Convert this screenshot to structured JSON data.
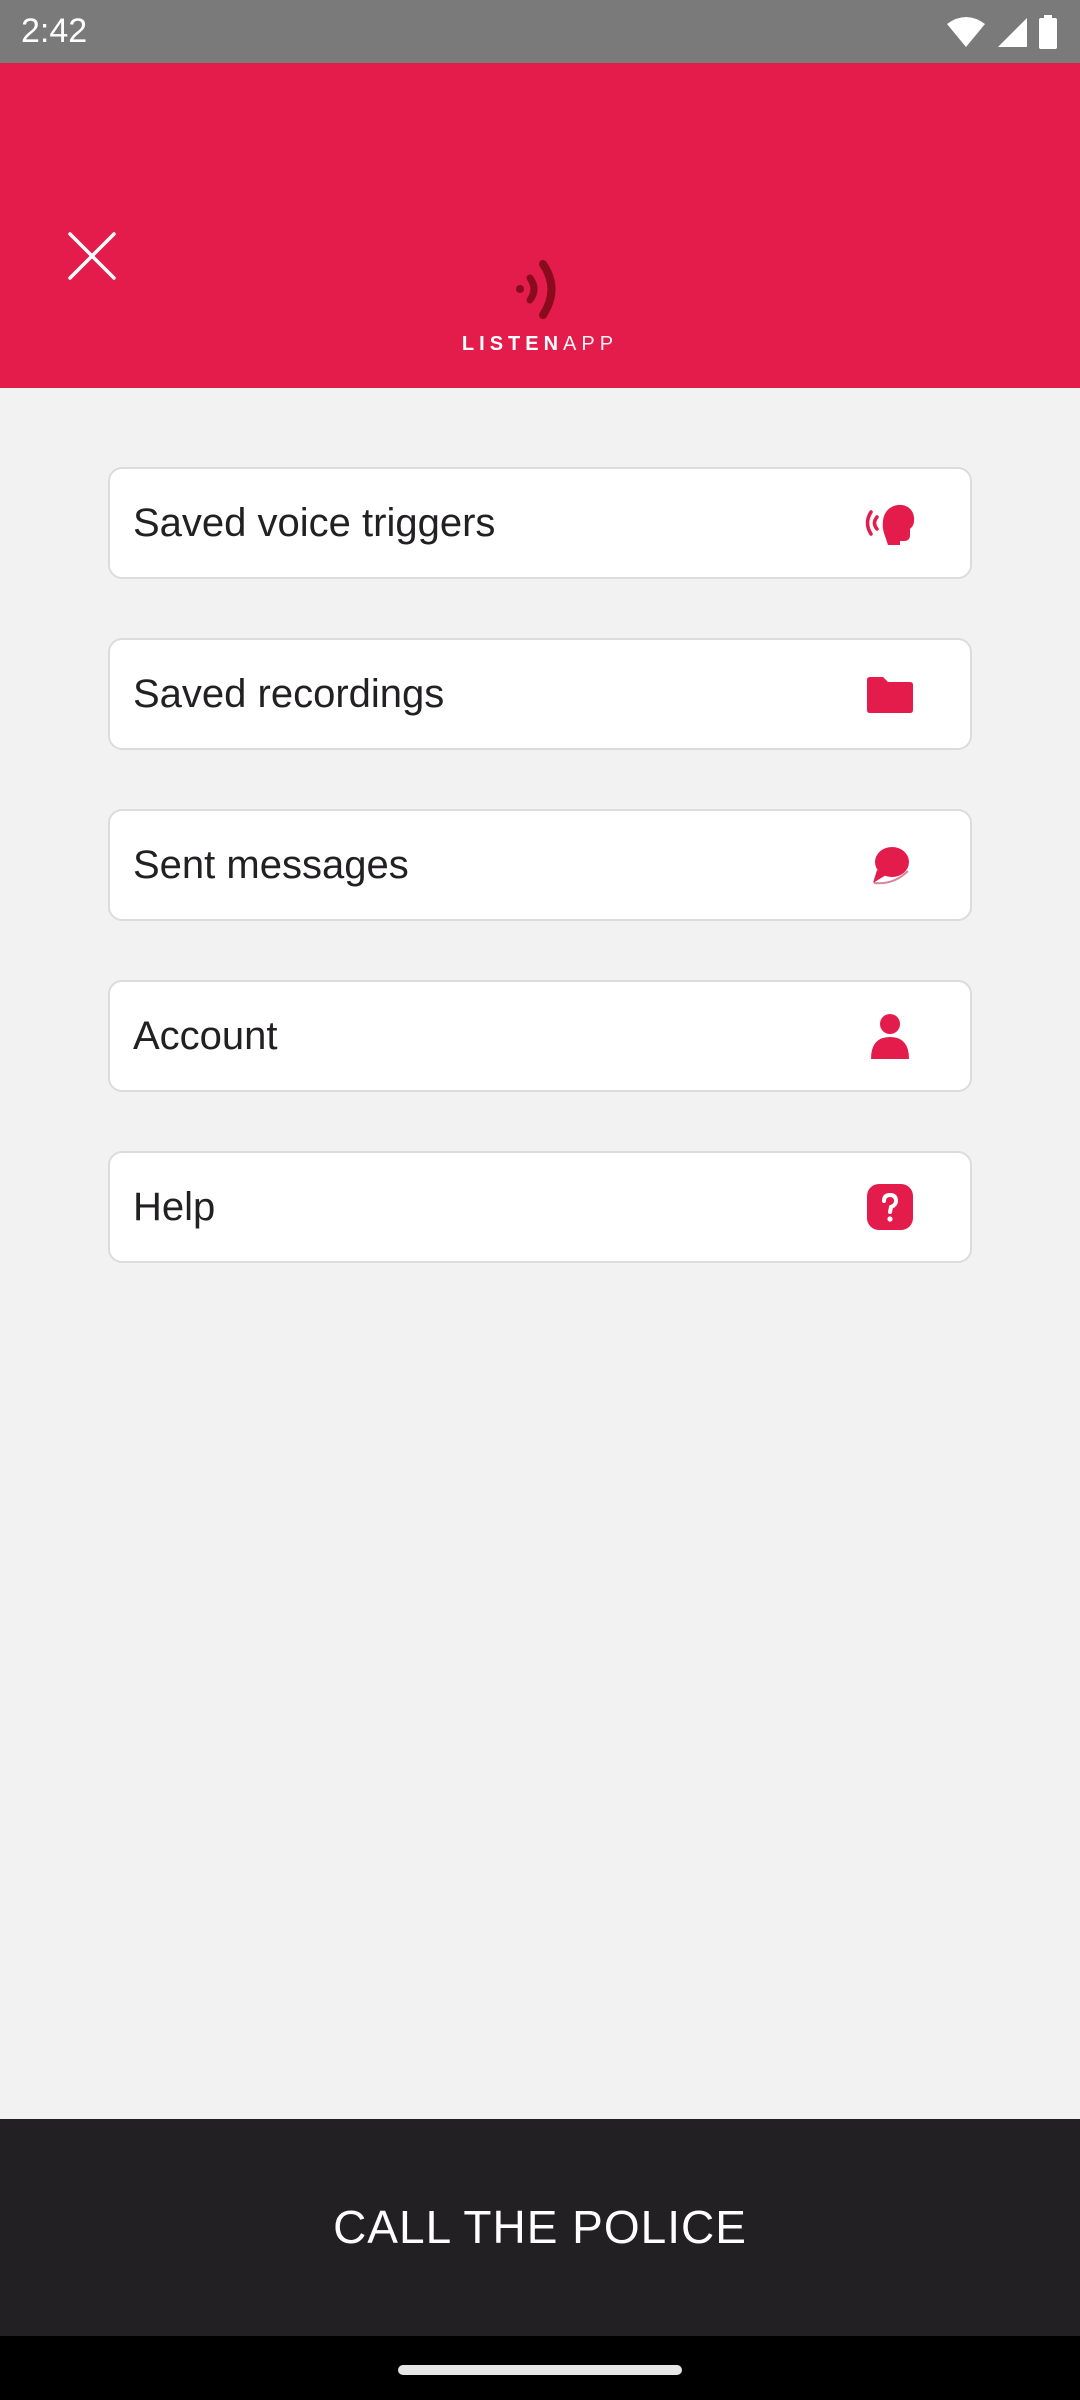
{
  "status_bar": {
    "time": "2:42",
    "icons": [
      "wifi-icon",
      "cellular-signal-icon",
      "battery-icon"
    ]
  },
  "header": {
    "background_color": "#e31c4c",
    "close_icon": "close-icon",
    "logo": {
      "icon": "signal-waves-icon",
      "text_bold": "LISTEN",
      "text_light": "APP"
    }
  },
  "menu": {
    "items": [
      {
        "label": "Saved voice triggers",
        "icon": "voice-trigger-icon"
      },
      {
        "label": "Saved recordings",
        "icon": "folder-icon"
      },
      {
        "label": "Sent messages",
        "icon": "chat-bubble-icon"
      },
      {
        "label": "Account",
        "icon": "person-icon"
      },
      {
        "label": "Help",
        "icon": "help-icon"
      }
    ]
  },
  "call_police": {
    "label": "CALL THE POLICE"
  },
  "colors": {
    "accent": "#e31c4c",
    "dark": "#232023",
    "background": "#f2f2f2"
  }
}
